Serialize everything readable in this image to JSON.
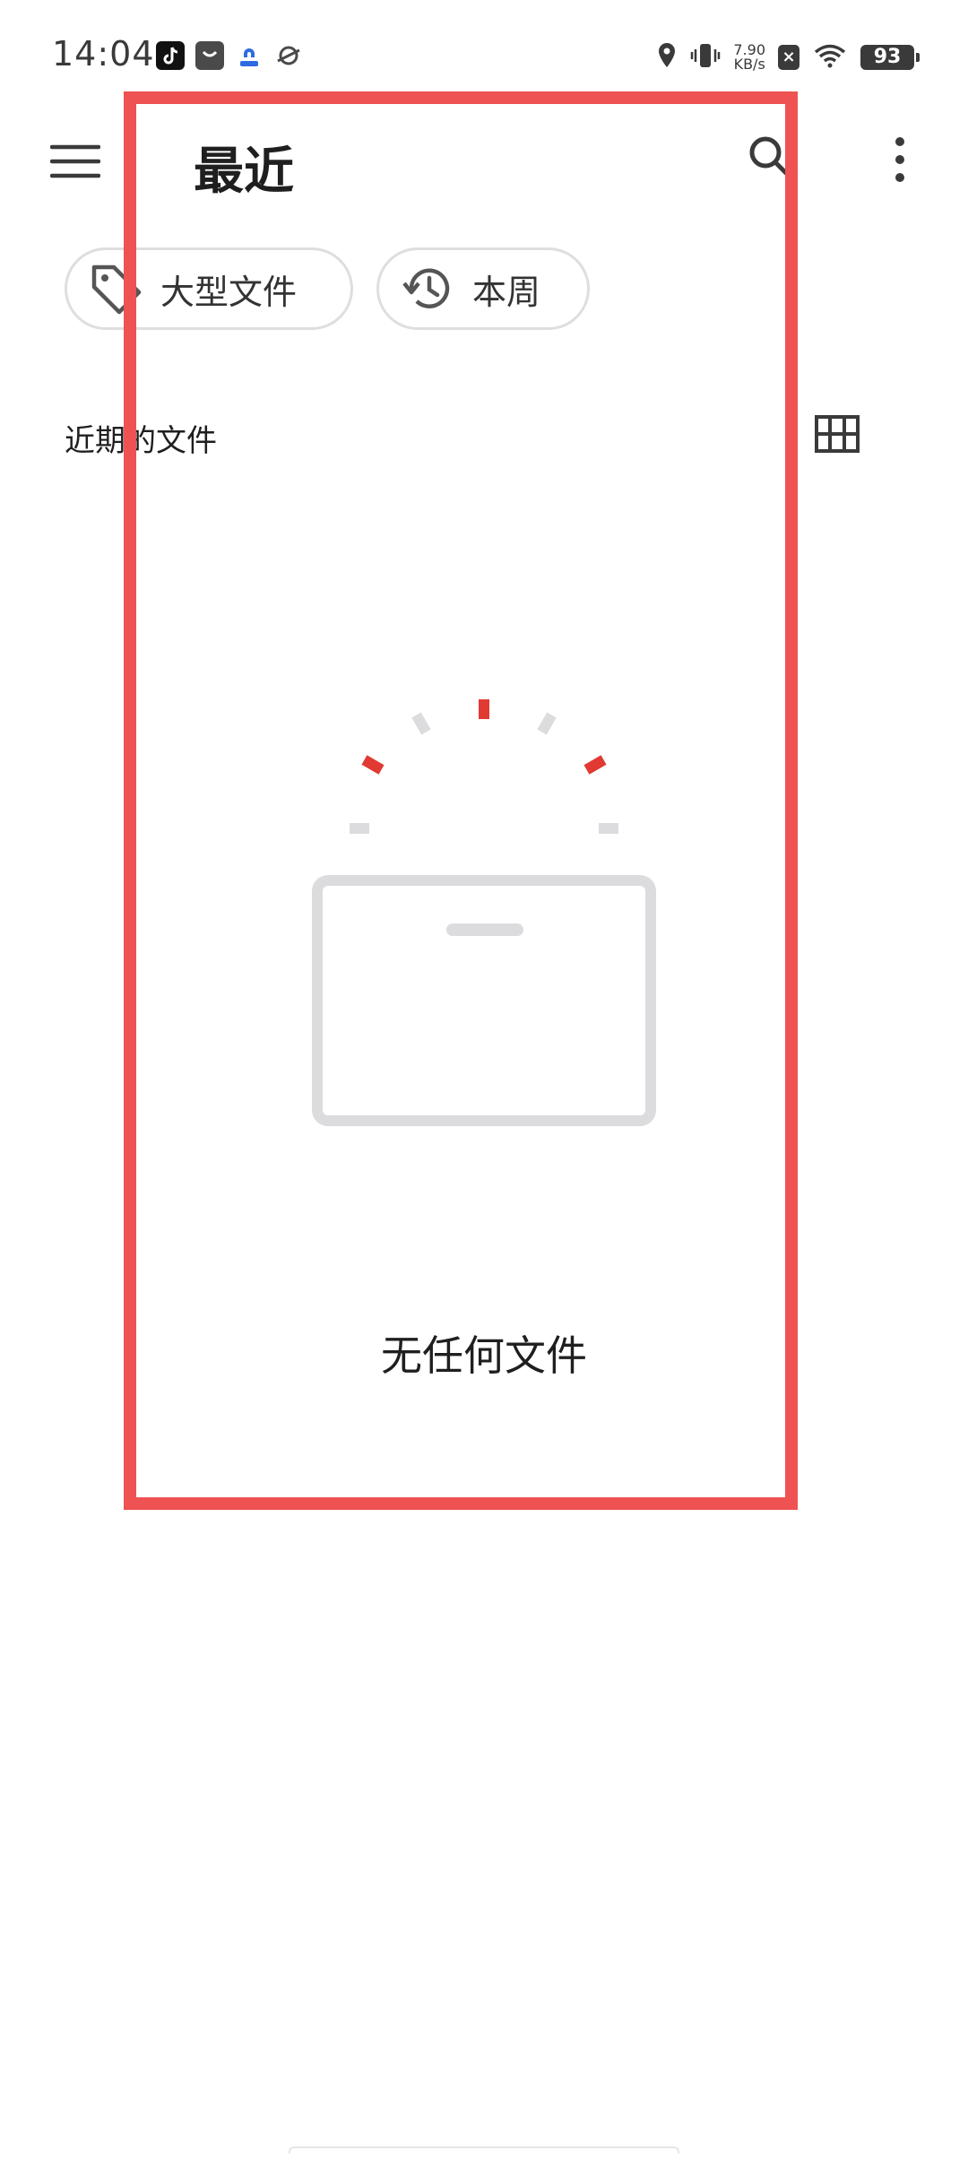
{
  "status_bar": {
    "time": "14:04",
    "net_speed_value": "7.90",
    "net_speed_unit": "KB/s",
    "battery": "93",
    "sim_badge": "×",
    "icons": [
      "tiktok-icon",
      "mall-icon",
      "baidu-netdisk-icon",
      "planet-icon",
      "location-icon",
      "vibrate-icon",
      "wifi-icon",
      "battery-icon"
    ]
  },
  "header": {
    "title": "最近",
    "icons": {
      "menu": "hamburger-menu-icon",
      "search": "search-icon",
      "more": "more-vert-icon"
    }
  },
  "filters": {
    "chips": [
      {
        "label": "大型文件",
        "icon": "tag-icon"
      },
      {
        "label": "本周",
        "icon": "history-icon"
      }
    ]
  },
  "section": {
    "title": "近期的文件",
    "view_toggle_icon": "grid-view-icon"
  },
  "empty_state": {
    "message": "无任何文件",
    "illustration": "empty-box-icon"
  },
  "colors": {
    "highlight": "#ee5252",
    "accent_red": "#e03a32",
    "illustration_gray": "#dcdcdf",
    "chip_border": "#dedede"
  }
}
